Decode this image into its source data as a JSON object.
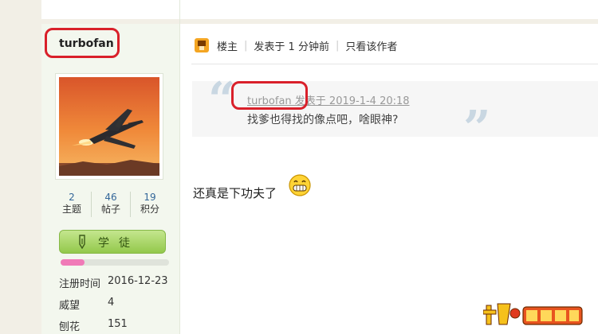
{
  "user": {
    "username": "turbofan",
    "stats": [
      {
        "value": "2",
        "label": "主题"
      },
      {
        "value": "46",
        "label": "帖子"
      },
      {
        "value": "19",
        "label": "积分"
      }
    ],
    "rank_label": "学徒",
    "rank_progress": 0.22,
    "info": [
      {
        "label": "注册时间",
        "value": "2016-12-23"
      },
      {
        "label": "威望",
        "value": "4"
      },
      {
        "label": "刨花",
        "value": "151"
      }
    ]
  },
  "post_header": {
    "owner": "楼主",
    "posted": "发表于 1 分钟前",
    "only_author": "只看该作者"
  },
  "quote": {
    "meta": "turbofan 发表于 2019-1-4 20:18",
    "text": "找爹也得找的像点吧，啥眼神?"
  },
  "reply_text": "还真是下功夫了",
  "colors": {
    "highlight_red": "#d9202a",
    "rank_green": "#93c84b",
    "progress_pink": "#f07ab7",
    "stat_blue": "#336699"
  },
  "icons": [
    "owner-icon",
    "pen-icon",
    "grin-emoji-icon",
    "site-logo"
  ]
}
